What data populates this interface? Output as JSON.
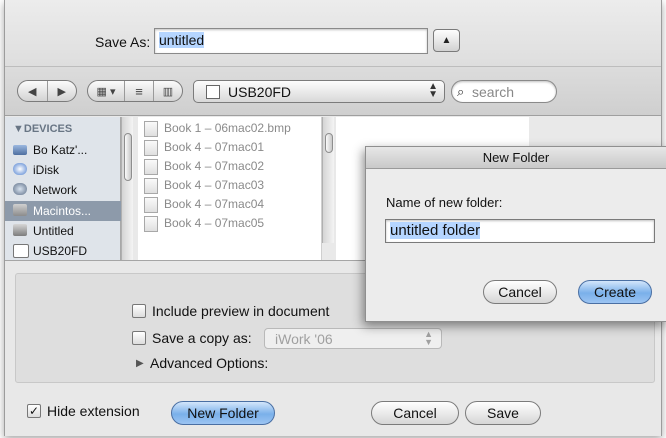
{
  "save_as": {
    "label": "Save As:",
    "value": "untitled"
  },
  "toolbar": {
    "location": "USB20FD",
    "search_placeholder": "search",
    "back_icon": "back-arrow-icon",
    "forward_icon": "forward-arrow-icon"
  },
  "sidebar": {
    "header": "DEVICES",
    "items": [
      {
        "label": "Bo Katz'...",
        "icon": "computer-icon",
        "selected": false
      },
      {
        "label": "iDisk",
        "icon": "idisk-icon",
        "selected": false
      },
      {
        "label": "Network",
        "icon": "network-icon",
        "selected": false
      },
      {
        "label": "Macintos...",
        "icon": "hard-drive-icon",
        "selected": true
      },
      {
        "label": "Untitled",
        "icon": "hard-drive-icon",
        "selected": false
      },
      {
        "label": "USB20FD",
        "icon": "usb-drive-icon",
        "selected": false
      }
    ]
  },
  "files": [
    "Book 1 – 06mac02.bmp",
    "Book 4 – 07mac01",
    "Book 4 – 07mac02",
    "Book 4 – 07mac03",
    "Book 4 – 07mac04",
    "Book 4 – 07mac05"
  ],
  "options": {
    "include_preview": "Include preview in document",
    "save_copy": "Save a copy as:",
    "copy_format": "iWork '06",
    "advanced": "Advanced Options:"
  },
  "footer": {
    "hide_extension": "Hide extension",
    "new_folder": "New Folder",
    "cancel": "Cancel",
    "save": "Save"
  },
  "new_folder_dialog": {
    "title": "New Folder",
    "prompt": "Name of new folder:",
    "value": "untitled folder",
    "cancel": "Cancel",
    "create": "Create"
  },
  "colors": {
    "accent": "#7ab0ea",
    "selection": "#b5d5ff",
    "sidebar_selected": "#8d9aaa"
  }
}
